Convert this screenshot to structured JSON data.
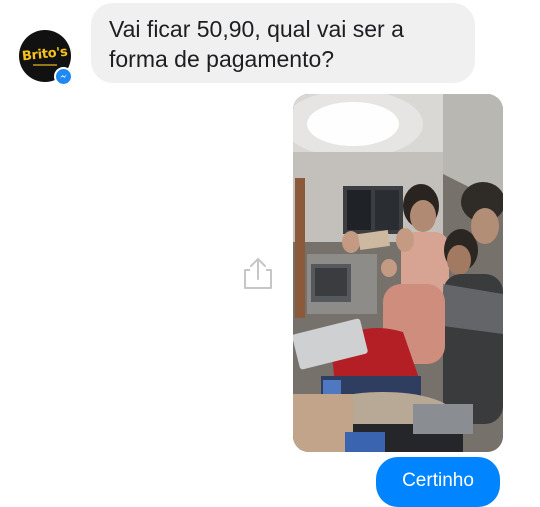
{
  "contact": {
    "avatar_logo_text": "Brito's",
    "badge_icon": "messenger-icon"
  },
  "messages": [
    {
      "direction": "incoming",
      "type": "text",
      "text": "Vai ficar 50,90, qual vai ser a\nforma de pagamento?"
    },
    {
      "direction": "outgoing",
      "type": "photo",
      "share_icon": "share-icon"
    },
    {
      "direction": "outgoing",
      "type": "text",
      "text": "Certinho"
    }
  ],
  "colors": {
    "incoming_bubble": "#f1f0f0",
    "outgoing_bubble": "#0084ff",
    "messenger_badge": "#1e88f3",
    "logo_text": "#f6c21c"
  }
}
